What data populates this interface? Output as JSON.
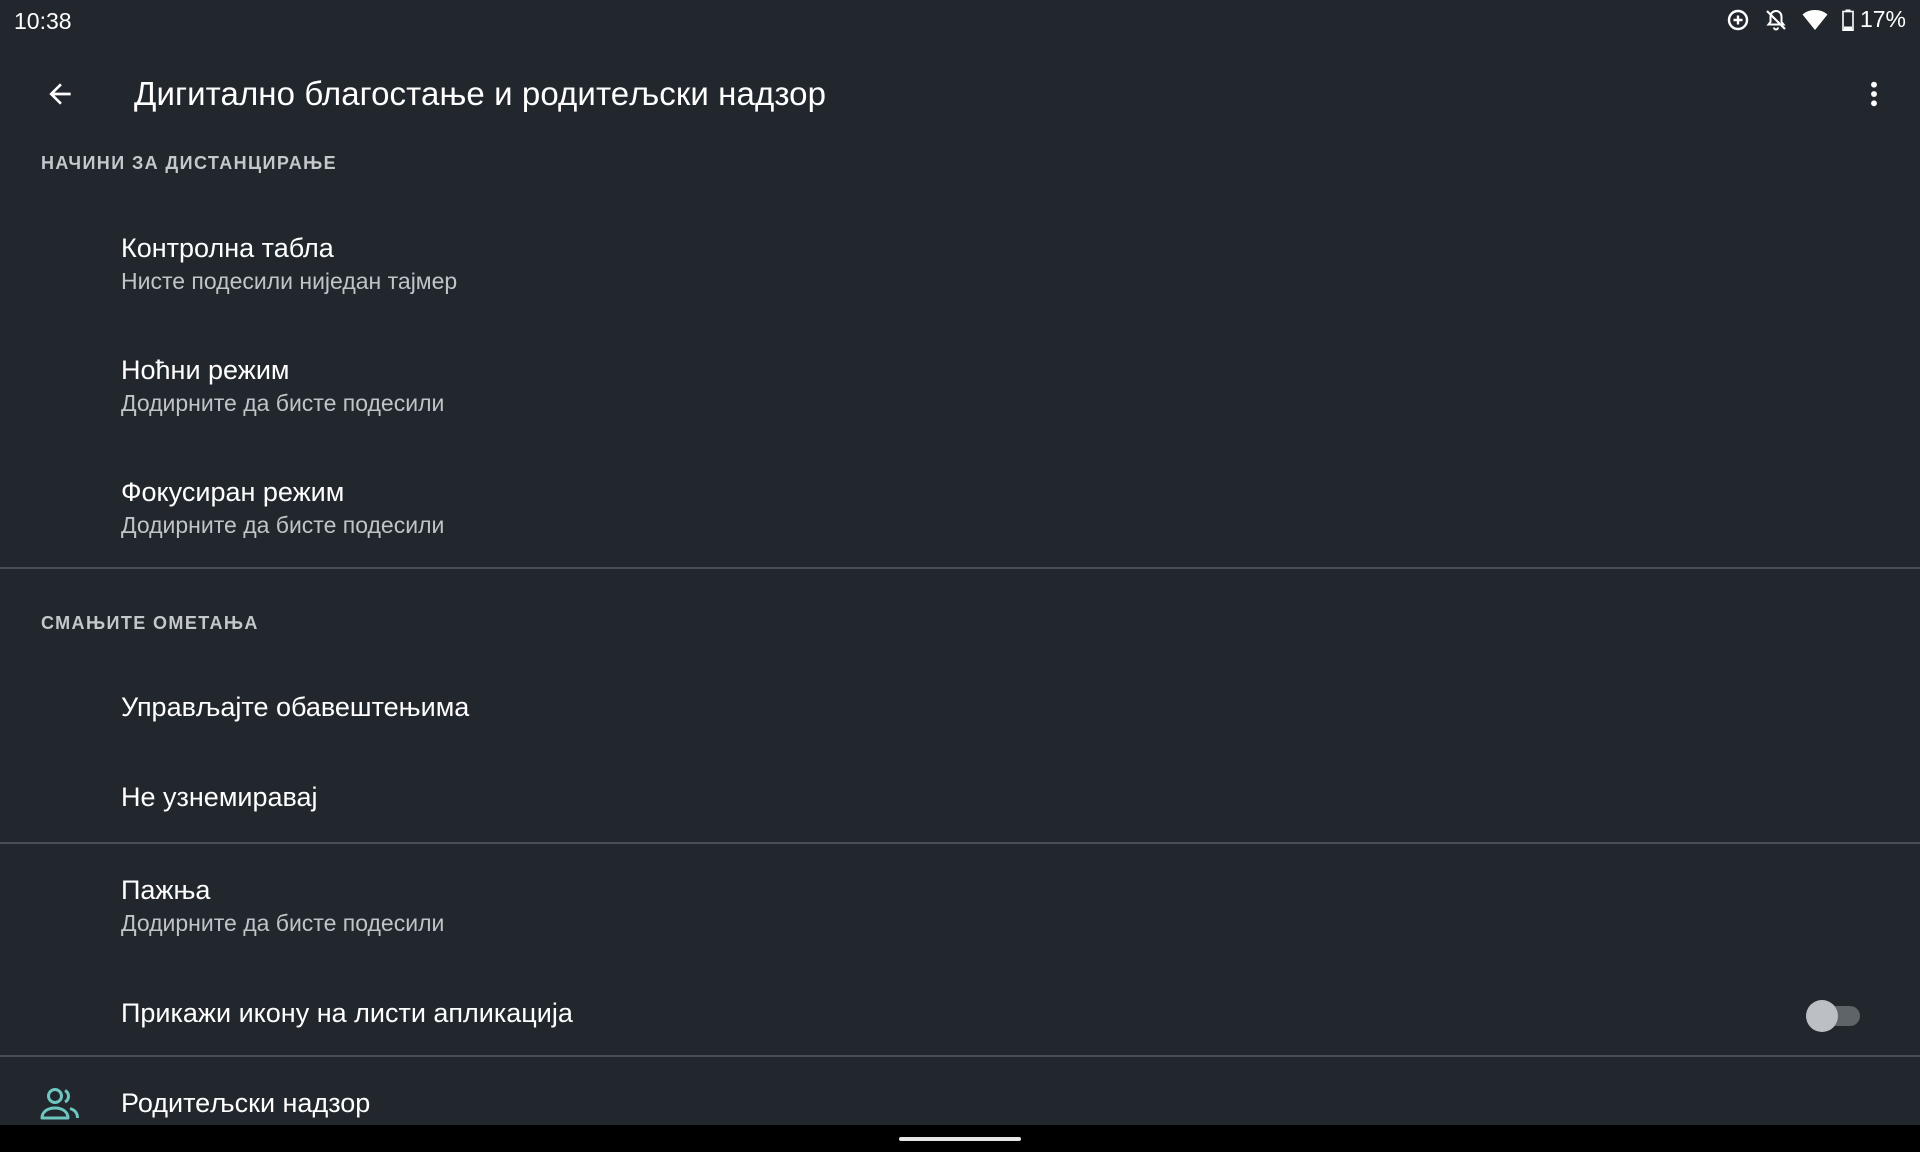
{
  "status_bar": {
    "time": "10:38",
    "battery_percent": "17%",
    "icons": [
      "data-saver-icon",
      "notifications-off-icon",
      "wifi-icon",
      "battery-icon"
    ]
  },
  "toolbar": {
    "title": "Дигитално благостање и родитељски надзор",
    "back_icon": "arrow-back-icon",
    "overflow_icon": "more-vert-icon"
  },
  "sections": {
    "disconnect": {
      "header": "НАЧИНИ ЗА ДИСТАНЦИРАЊЕ",
      "items": [
        {
          "title": "Контролна табла",
          "summary": "Нисте подесили ниједан тајмер"
        },
        {
          "title": "Ноћни режим",
          "summary": "Додирните да бисте подесили"
        },
        {
          "title": "Фокусиран режим",
          "summary": "Додирните да бисте подесили"
        }
      ]
    },
    "interruptions": {
      "header": "СМАЊИТЕ ОМЕТАЊА",
      "items": [
        {
          "title": "Управљајте обавештењима"
        },
        {
          "title": "Не узнемиравај"
        }
      ]
    },
    "misc": {
      "items": [
        {
          "title": "Пажња",
          "summary": "Додирните да бисте подесили"
        },
        {
          "title": "Прикажи икону на листи апликација",
          "toggle_on": false
        }
      ]
    },
    "parental": {
      "title": "Родитељски надзор",
      "icon": "people-icon"
    }
  },
  "colors": {
    "background": "#22272e",
    "accent": "#6ec6c0",
    "divider": "#4a4f55"
  }
}
